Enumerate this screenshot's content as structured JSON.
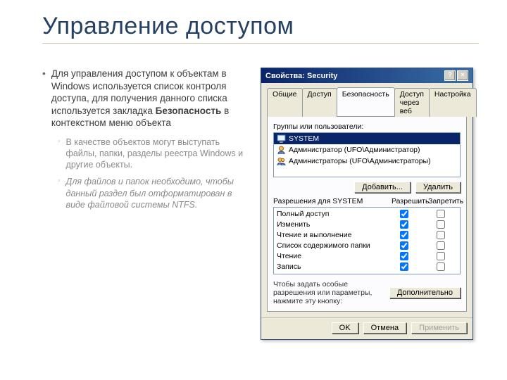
{
  "slide": {
    "title": "Управление доступом",
    "bullet_main": "Для управления доступом к объектам в Windows используется список контроля доступа, для получения данного списка используется закладка ",
    "bullet_main_bold": "Безопасность",
    "bullet_main_tail": " в контекстном меню объекта",
    "sub1": "В качестве объектов могут выступать файлы, папки, разделы реестра Windows и другие объекты.",
    "sub2": "Для файлов и папок необходимо, чтобы данный раздел был отформатирован в виде файловой системы NTFS."
  },
  "dialog": {
    "title": "Свойства: Security",
    "tabs": [
      "Общие",
      "Доступ",
      "Безопасность",
      "Доступ через веб",
      "Настройка"
    ],
    "active_tab": 2,
    "groups_label": "Группы или пользователи:",
    "groups": [
      "SYSTEM",
      "Администратор (UFO\\Администратор)",
      "Администраторы (UFO\\Администраторы)"
    ],
    "selected_group": 0,
    "buttons": {
      "add": "Добавить...",
      "remove": "Удалить"
    },
    "perm_title": "Разрешения для SYSTEM",
    "perm_cols": [
      "Разрешить",
      "Запретить"
    ],
    "perms": [
      {
        "name": "Полный доступ",
        "allow": true,
        "deny": false
      },
      {
        "name": "Изменить",
        "allow": true,
        "deny": false
      },
      {
        "name": "Чтение и выполнение",
        "allow": true,
        "deny": false
      },
      {
        "name": "Список содержимого папки",
        "allow": true,
        "deny": false
      },
      {
        "name": "Чтение",
        "allow": true,
        "deny": false
      },
      {
        "name": "Запись",
        "allow": true,
        "deny": false
      }
    ],
    "note": "Чтобы задать особые разрешения или параметры, нажмите эту кнопку:",
    "advanced": "Дополнительно",
    "footer": {
      "ok": "OK",
      "cancel": "Отмена",
      "apply": "Применить"
    }
  }
}
